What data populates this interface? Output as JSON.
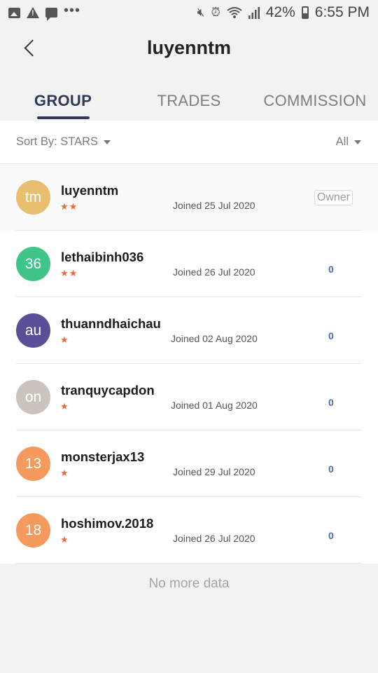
{
  "status_bar": {
    "left_icons": [
      "image-icon",
      "warning-icon",
      "message-icon",
      "more-dots-icon"
    ],
    "battery": "42%",
    "time": "6:55 PM"
  },
  "header": {
    "title": "luyenntm"
  },
  "tabs": [
    {
      "label": "GROUP",
      "active": true
    },
    {
      "label": "TRADES",
      "active": false
    },
    {
      "label": "COMMISSION",
      "active": false
    }
  ],
  "sort": {
    "label": "Sort By: STARS",
    "filter": "All"
  },
  "members": [
    {
      "initials": "tm",
      "avatar_color": "#e8bf6f",
      "username": "luyenntm",
      "stars": 2,
      "joined": "Joined 25 Jul 2020",
      "badge": "Owner",
      "count": ""
    },
    {
      "initials": "36",
      "avatar_color": "#3fc48a",
      "username": "lethaibinh036",
      "stars": 2,
      "joined": "Joined 26 Jul 2020",
      "badge": "",
      "count": "0"
    },
    {
      "initials": "au",
      "avatar_color": "#5a4f96",
      "username": "thuanndhaichau",
      "stars": 1,
      "joined": "Joined 02 Aug 2020",
      "badge": "",
      "count": "0"
    },
    {
      "initials": "on",
      "avatar_color": "#cbc4bc",
      "username": "tranquycapdon",
      "stars": 1,
      "joined": "Joined 01 Aug 2020",
      "badge": "",
      "count": "0"
    },
    {
      "initials": "13",
      "avatar_color": "#f39a5c",
      "username": "monsterjax13",
      "stars": 1,
      "joined": "Joined 29 Jul 2020",
      "badge": "",
      "count": "0"
    },
    {
      "initials": "18",
      "avatar_color": "#f39a5c",
      "username": "hoshimov.2018",
      "stars": 1,
      "joined": "Joined 26 Jul 2020",
      "badge": "",
      "count": "0"
    }
  ],
  "footer": {
    "no_more": "No more data"
  },
  "colors": {
    "accent": "#333a57",
    "star": "#ef6a3a",
    "count": "#4a6aa8"
  }
}
